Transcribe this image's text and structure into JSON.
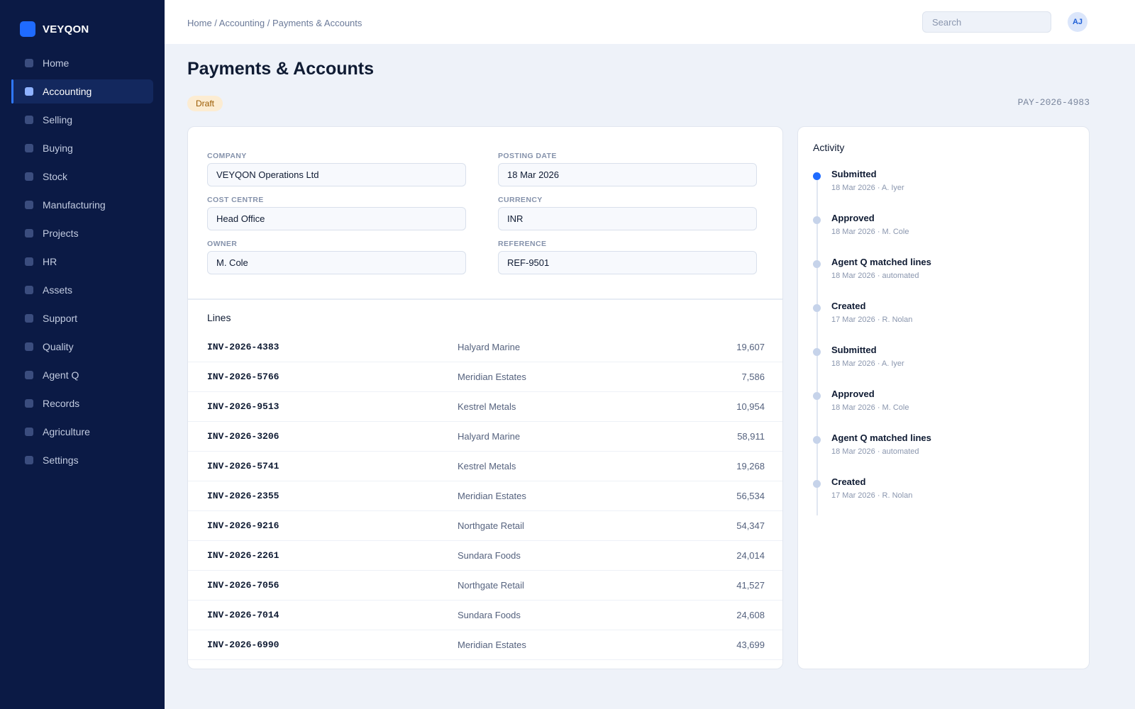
{
  "app": {
    "brand": "VEYQON"
  },
  "sidebar": {
    "items": [
      {
        "label": "Home"
      },
      {
        "label": "Accounting"
      },
      {
        "label": "Selling"
      },
      {
        "label": "Buying"
      },
      {
        "label": "Stock"
      },
      {
        "label": "Manufacturing"
      },
      {
        "label": "Projects"
      },
      {
        "label": "HR"
      },
      {
        "label": "Assets"
      },
      {
        "label": "Support"
      },
      {
        "label": "Quality"
      },
      {
        "label": "Agent Q"
      },
      {
        "label": "Records"
      },
      {
        "label": "Agriculture"
      },
      {
        "label": "Settings"
      }
    ],
    "active": "Accounting"
  },
  "header": {
    "breadcrumb": "Home / Accounting / Payments & Accounts",
    "search_placeholder": "Search",
    "search_value": "",
    "avatar_initials": "AJ"
  },
  "page": {
    "title": "Payments & Accounts",
    "status": "Draft",
    "doc_id": "PAY-2026-4983"
  },
  "form": {
    "company": {
      "label": "COMPANY",
      "value": "VEYQON Operations Ltd"
    },
    "posting_date": {
      "label": "POSTING DATE",
      "value": "18 Mar 2026"
    },
    "cost_centre": {
      "label": "COST CENTRE",
      "value": "Head Office"
    },
    "currency": {
      "label": "CURRENCY",
      "value": "INR"
    },
    "owner": {
      "label": "OWNER",
      "value": "M. Cole"
    },
    "reference": {
      "label": "REFERENCE",
      "value": "REF-9501"
    }
  },
  "lines": {
    "title": "Lines",
    "rows": [
      {
        "invoice": "INV-2026-4383",
        "party": "Halyard Marine",
        "amount": "19,607"
      },
      {
        "invoice": "INV-2026-5766",
        "party": "Meridian Estates",
        "amount": "7,586"
      },
      {
        "invoice": "INV-2026-9513",
        "party": "Kestrel Metals",
        "amount": "10,954"
      },
      {
        "invoice": "INV-2026-3206",
        "party": "Halyard Marine",
        "amount": "58,911"
      },
      {
        "invoice": "INV-2026-5741",
        "party": "Kestrel Metals",
        "amount": "19,268"
      },
      {
        "invoice": "INV-2026-2355",
        "party": "Meridian Estates",
        "amount": "56,534"
      },
      {
        "invoice": "INV-2026-9216",
        "party": "Northgate Retail",
        "amount": "54,347"
      },
      {
        "invoice": "INV-2026-2261",
        "party": "Sundara Foods",
        "amount": "24,014"
      },
      {
        "invoice": "INV-2026-7056",
        "party": "Northgate Retail",
        "amount": "41,527"
      },
      {
        "invoice": "INV-2026-7014",
        "party": "Sundara Foods",
        "amount": "24,608"
      },
      {
        "invoice": "INV-2026-6990",
        "party": "Meridian Estates",
        "amount": "43,699"
      }
    ]
  },
  "activity": {
    "title": "Activity",
    "events": [
      {
        "title": "Submitted",
        "meta": "18 Mar 2026 · A. Iyer"
      },
      {
        "title": "Approved",
        "meta": "18 Mar 2026 · M. Cole"
      },
      {
        "title": "Agent Q matched lines",
        "meta": "18 Mar 2026 · automated"
      },
      {
        "title": "Created",
        "meta": "17 Mar 2026 · R. Nolan"
      },
      {
        "title": "Submitted",
        "meta": "18 Mar 2026 · A. Iyer"
      },
      {
        "title": "Approved",
        "meta": "18 Mar 2026 · M. Cole"
      },
      {
        "title": "Agent Q matched lines",
        "meta": "18 Mar 2026 · automated"
      },
      {
        "title": "Created",
        "meta": "17 Mar 2026 · R. Nolan"
      }
    ]
  },
  "colors": {
    "sidebar_bg": "#0b1a45",
    "accent": "#1f6bff",
    "page_bg": "#eef2f9",
    "status_draft_bg": "#fcecd2",
    "status_draft_text": "#9a5a00"
  }
}
